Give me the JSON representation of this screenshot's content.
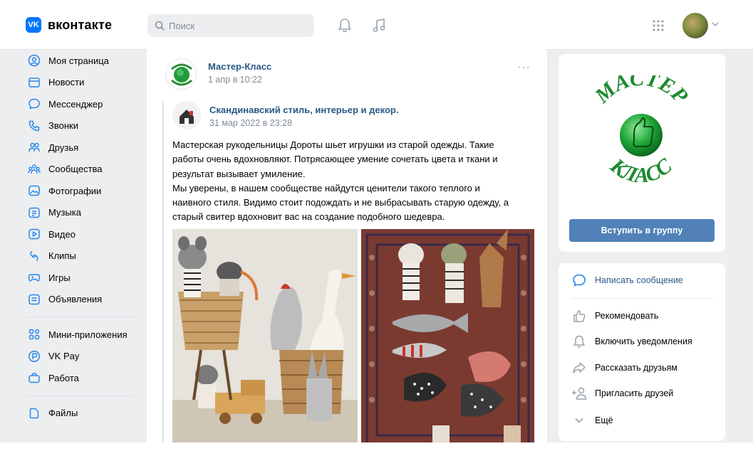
{
  "header": {
    "logo_mark": "VK",
    "logo_text": "вконтакте",
    "search_placeholder": "Поиск"
  },
  "sidebar": {
    "items": [
      {
        "label": "Моя страница",
        "icon": "user-circle-icon"
      },
      {
        "label": "Новости",
        "icon": "newspaper-icon"
      },
      {
        "label": "Мессенджер",
        "icon": "chat-bubble-icon"
      },
      {
        "label": "Звонки",
        "icon": "phone-icon"
      },
      {
        "label": "Друзья",
        "icon": "friends-icon"
      },
      {
        "label": "Сообщества",
        "icon": "communities-icon"
      },
      {
        "label": "Фотографии",
        "icon": "photo-icon"
      },
      {
        "label": "Музыка",
        "icon": "music-icon"
      },
      {
        "label": "Видео",
        "icon": "video-icon"
      },
      {
        "label": "Клипы",
        "icon": "clips-icon"
      },
      {
        "label": "Игры",
        "icon": "gamepad-icon"
      },
      {
        "label": "Объявления",
        "icon": "ads-icon"
      }
    ],
    "items2": [
      {
        "label": "Мини-приложения",
        "icon": "mini-apps-icon"
      },
      {
        "label": "VK Pay",
        "icon": "vkpay-icon"
      },
      {
        "label": "Работа",
        "icon": "briefcase-icon"
      }
    ],
    "items3": [
      {
        "label": "Файлы",
        "icon": "file-icon"
      }
    ]
  },
  "post": {
    "author": "Мастер-Класс",
    "date": "1 апр в 10:22",
    "more": "···",
    "repost_author": "Скандинавский стиль, интерьер и декор.",
    "repost_date": "31 мар 2022 в 23:28",
    "text_lines": [
      "Мастерская рукодельницы Дороты шьет игрушки из старой одежды. Такие",
      "работы очень вдохновляют. Потрясающее умение сочетать цвета и ткани и",
      "результат вызывает умиление.",
      "Мы уверены, в нашем сообществе найдутся ценители такого теплого и",
      "наивного стиля. Видимо стоит подождать и не выбрасывать старую одежду, а",
      "старый свитер вдохновит вас на создание подобного шедевра."
    ]
  },
  "group": {
    "logo_top": "МАСТЕР",
    "logo_bottom": "КЛАСС",
    "join_label": "Вступить в группу"
  },
  "actions": [
    {
      "label": "Написать сообщение",
      "icon": "message-icon"
    },
    {
      "label": "Рекомендовать",
      "icon": "thumbs-up-icon"
    },
    {
      "label": "Включить уведомления",
      "icon": "bell-icon"
    },
    {
      "label": "Рассказать друзьям",
      "icon": "share-icon"
    },
    {
      "label": "Пригласить друзей",
      "icon": "invite-icon"
    },
    {
      "label": "Ещё",
      "icon": "chevron-down-icon"
    }
  ],
  "colors": {
    "accent": "#0077ff",
    "link": "#2a5885",
    "button": "#5181b8",
    "icon": "#2688eb"
  }
}
